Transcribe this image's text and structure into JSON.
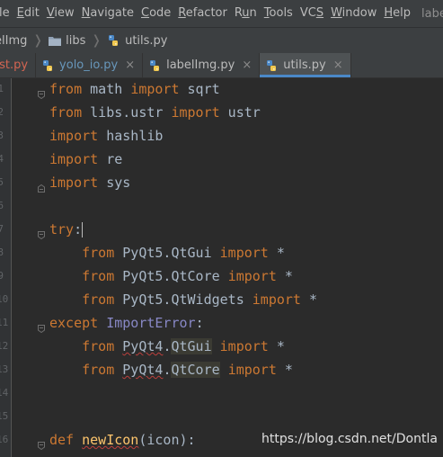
{
  "menu": {
    "items": [
      {
        "label": "le",
        "mnemonic": ""
      },
      {
        "label": "Edit",
        "mnemonic": "E"
      },
      {
        "label": "View",
        "mnemonic": "V"
      },
      {
        "label": "Navigate",
        "mnemonic": "N"
      },
      {
        "label": "Code",
        "mnemonic": "C"
      },
      {
        "label": "Refactor",
        "mnemonic": "R"
      },
      {
        "label": "Run",
        "mnemonic": "u"
      },
      {
        "label": "Tools",
        "mnemonic": "T"
      },
      {
        "label": "VCS",
        "mnemonic": "S"
      },
      {
        "label": "Window",
        "mnemonic": "W"
      },
      {
        "label": "Help",
        "mnemonic": "H"
      }
    ],
    "window_title": "labe"
  },
  "breadcrumb": {
    "items": [
      "elImg",
      "libs",
      "utils.py"
    ]
  },
  "tabs": [
    {
      "label": "test.py",
      "style": "modified",
      "close": ""
    },
    {
      "label": "yolo_io.py",
      "style": "vcs",
      "close": "×"
    },
    {
      "label": "labelImg.py",
      "style": "plain",
      "close": "×"
    },
    {
      "label": "utils.py",
      "style": "plain",
      "close": "×",
      "active": true
    }
  ],
  "gutter": {
    "line_numbers": [
      "1",
      "2",
      "3",
      "4",
      "5",
      "6",
      "7",
      "8",
      "9",
      "10",
      "11",
      "12",
      "13",
      "14",
      "15",
      "16"
    ]
  },
  "code": {
    "lines": [
      [
        [
          "kw",
          "from"
        ],
        [
          "t",
          " math "
        ],
        [
          "kw",
          "import"
        ],
        [
          "t",
          " sqrt"
        ]
      ],
      [
        [
          "kw",
          "from"
        ],
        [
          "t",
          " libs.ustr "
        ],
        [
          "kw",
          "import"
        ],
        [
          "t",
          " ustr"
        ]
      ],
      [
        [
          "kw",
          "import"
        ],
        [
          "t",
          " hashlib"
        ]
      ],
      [
        [
          "kw",
          "import"
        ],
        [
          "t",
          " re"
        ]
      ],
      [
        [
          "kw",
          "import"
        ],
        [
          "t",
          " sys"
        ]
      ],
      [],
      [
        [
          "kw",
          "try"
        ],
        [
          "t",
          ":"
        ],
        [
          "caret",
          ""
        ]
      ],
      [
        [
          "t",
          "    "
        ],
        [
          "kw",
          "from"
        ],
        [
          "t",
          " PyQt5.QtGui "
        ],
        [
          "kw",
          "import"
        ],
        [
          "t",
          " *"
        ]
      ],
      [
        [
          "t",
          "    "
        ],
        [
          "kw",
          "from"
        ],
        [
          "t",
          " PyQt5.QtCore "
        ],
        [
          "kw",
          "import"
        ],
        [
          "t",
          " *"
        ]
      ],
      [
        [
          "t",
          "    "
        ],
        [
          "kw",
          "from"
        ],
        [
          "t",
          " PyQt5.QtWidgets "
        ],
        [
          "kw",
          "import"
        ],
        [
          "t",
          " *"
        ]
      ],
      [
        [
          "kw",
          "except"
        ],
        [
          "t",
          " "
        ],
        [
          "cls",
          "ImportError"
        ],
        [
          "t",
          ":"
        ]
      ],
      [
        [
          "t",
          "    "
        ],
        [
          "kw",
          "from"
        ],
        [
          "t",
          " "
        ],
        [
          "squig",
          "PyQt4"
        ],
        [
          "t",
          "."
        ],
        [
          "hl",
          "QtGui"
        ],
        [
          "t",
          " "
        ],
        [
          "kw",
          "import"
        ],
        [
          "t",
          " *"
        ]
      ],
      [
        [
          "t",
          "    "
        ],
        [
          "kw",
          "from"
        ],
        [
          "t",
          " "
        ],
        [
          "squig",
          "PyQt4"
        ],
        [
          "t",
          "."
        ],
        [
          "hl",
          "QtCore"
        ],
        [
          "t",
          " "
        ],
        [
          "kw",
          "import"
        ],
        [
          "t",
          " *"
        ]
      ],
      [],
      [],
      [
        [
          "kw",
          "def"
        ],
        [
          "t",
          " "
        ],
        [
          "fnsq",
          "newIcon"
        ],
        [
          "t",
          "(icon):"
        ]
      ]
    ]
  },
  "watermark": "https://blog.csdn.net/Dontla",
  "colors": {
    "keyword": "#cc7832",
    "builtin_class": "#8888c6",
    "function_name": "#ffc66d",
    "default_text": "#a9b7c6",
    "background": "#2b2b2b",
    "active_tab_underline": "#4a88c7"
  }
}
